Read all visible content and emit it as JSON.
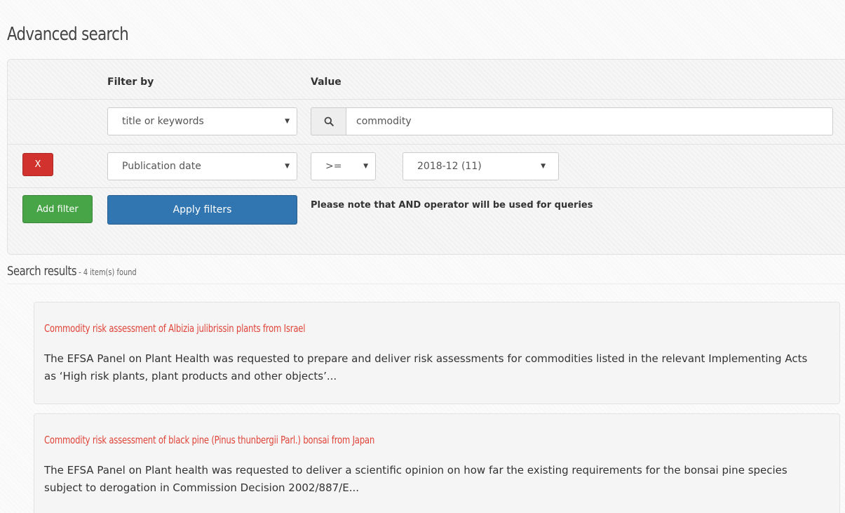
{
  "page": {
    "title": "Advanced search"
  },
  "filters": {
    "header_filter_by": "Filter by",
    "header_value": "Value",
    "row1": {
      "field": "title or keywords",
      "value": "commodity"
    },
    "row2": {
      "remove_label": "X",
      "field": "Publication date",
      "operator": ">=",
      "value": "2018-12 (11)"
    },
    "add_filter_label": "Add filter",
    "apply_filters_label": "Apply filters",
    "note": "Please note that AND operator will be used for queries"
  },
  "results": {
    "heading": "Search results",
    "count": " - 4 item(s) found",
    "items": [
      {
        "title": "Commodity risk assessment of Albizia julibrissin plants from Israel",
        "summary": "The EFSA Panel on Plant Health was requested to prepare and deliver risk assessments for commodities listed in the relevant Implementing Acts as ‘High risk plants, plant products and other objects’..."
      },
      {
        "title": "Commodity risk assessment of black pine (Pinus thunbergii Parl.) bonsai from Japan",
        "summary": "The EFSA Panel on Plant health was requested to deliver a scientific opinion on how far the existing requirements for the bonsai pine species subject to derogation in Commission Decision 2002/887/E..."
      }
    ]
  },
  "icons": {
    "search": "search-icon",
    "dropdown": "caret-down-icon"
  },
  "colors": {
    "remove_button": "#d2322d",
    "add_button": "#47a447",
    "apply_button": "#3276b1",
    "result_title": "#e0453a"
  }
}
